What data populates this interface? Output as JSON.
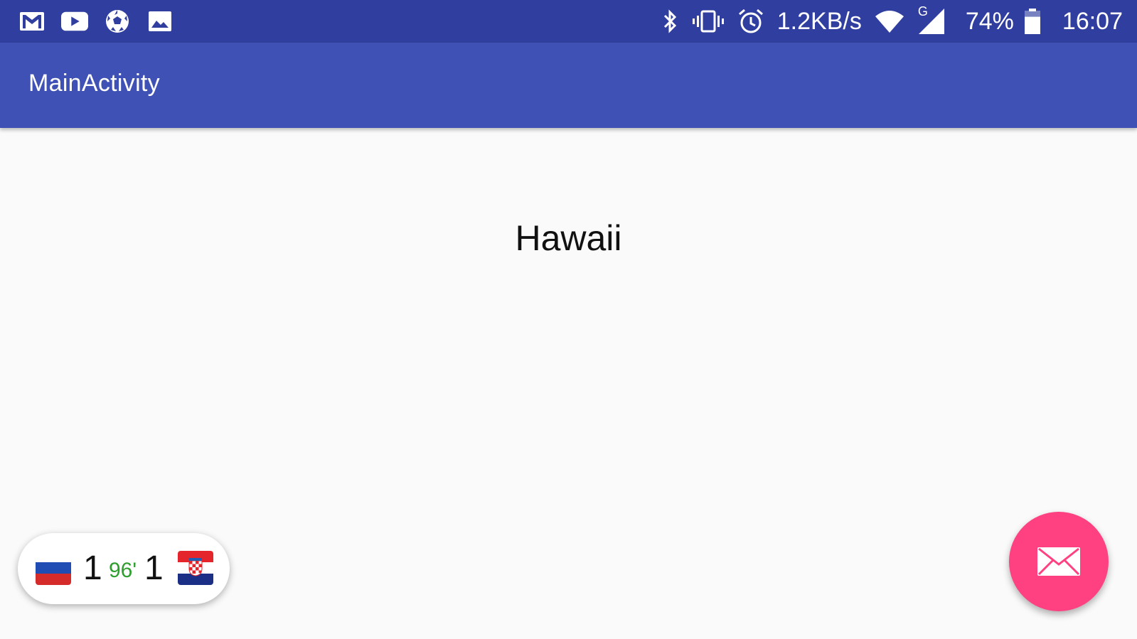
{
  "status_bar": {
    "left_icons": [
      "gmail-icon",
      "youtube-icon",
      "soccer-ball-icon",
      "image-icon"
    ],
    "right_icons": [
      "bluetooth-icon",
      "vibrate-icon",
      "alarm-icon",
      "wifi-icon",
      "signal-icon",
      "battery-icon"
    ],
    "network_speed": "1.2KB/s",
    "signal_type": "G",
    "battery_percent": "74%",
    "battery_level": 0.74,
    "time": "16:07"
  },
  "app_bar": {
    "title": "MainActivity"
  },
  "main": {
    "text": "Hawaii"
  },
  "score_widget": {
    "home_flag": "russia-flag-icon",
    "home_score": "1",
    "minute": "96'",
    "away_score": "1",
    "away_flag": "croatia-flag-icon"
  },
  "fab": {
    "icon": "mail-icon"
  },
  "colors": {
    "status_bar": "#303f9f",
    "app_bar": "#3f51b5",
    "background": "#fafafa",
    "fab": "#ff4081",
    "minute": "#2e9e2e"
  }
}
